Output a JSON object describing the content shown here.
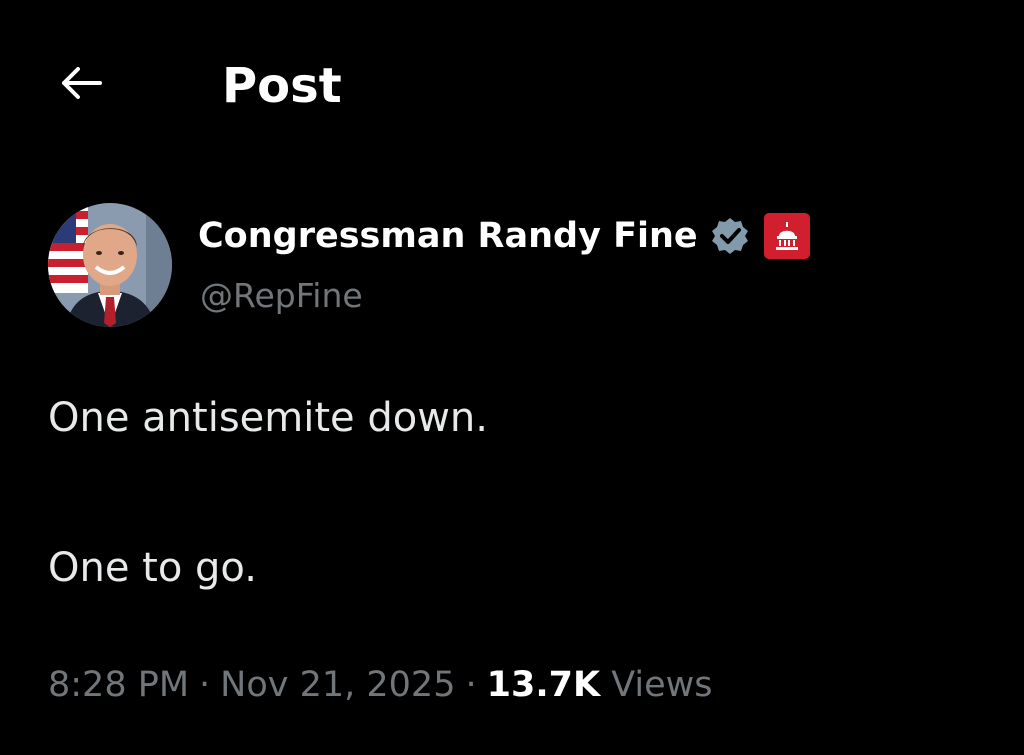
{
  "header": {
    "title": "Post"
  },
  "author": {
    "display_name": "Congressman Randy Fine",
    "handle": "@RepFine",
    "verified_color": "#829aab",
    "affiliation_color": "#d21f2e"
  },
  "post": {
    "lines": [
      "One antisemite down.",
      "One to go."
    ],
    "time": "8:28 PM",
    "date": "Nov 21, 2025",
    "views_count": "13.7K",
    "views_label": "Views",
    "separator": "·"
  },
  "colors": {
    "background": "#000000",
    "text_primary": "#e7e9ea",
    "text_secondary": "#71767b"
  }
}
